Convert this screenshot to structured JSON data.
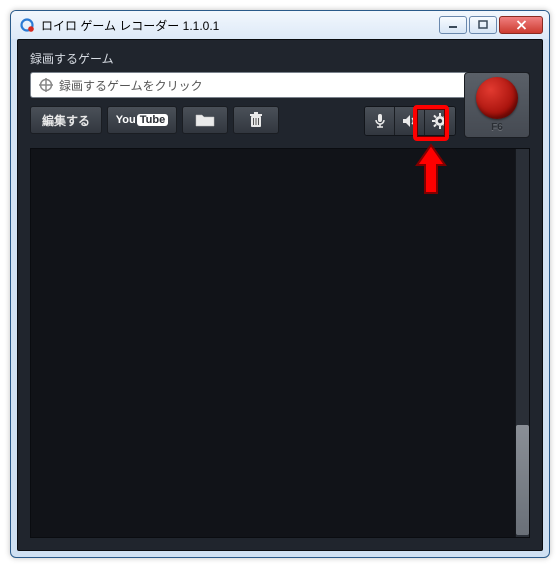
{
  "window": {
    "title": "ロイロ ゲーム レコーダー 1.1.0.1"
  },
  "section": {
    "label": "録画するゲーム"
  },
  "search": {
    "placeholder": "録画するゲームをクリック",
    "browse_label": "...",
    "icon": "crosshair-icon"
  },
  "record": {
    "hotkey": "F6",
    "icon": "record-icon"
  },
  "toolbar": {
    "edit_label": "編集する",
    "youtube_label": "YouTube",
    "folder_icon": "folder-icon",
    "trash_icon": "trash-icon",
    "mic_icon": "microphone-icon",
    "speaker_icon": "speaker-icon",
    "gear_icon": "gear-icon"
  },
  "annotation": {
    "highlight_target": "settings-button",
    "arrow_color": "#ff0000"
  },
  "colors": {
    "bg_dark": "#20252d",
    "accent_red": "#ff0000",
    "record_red": "#c0180d"
  }
}
